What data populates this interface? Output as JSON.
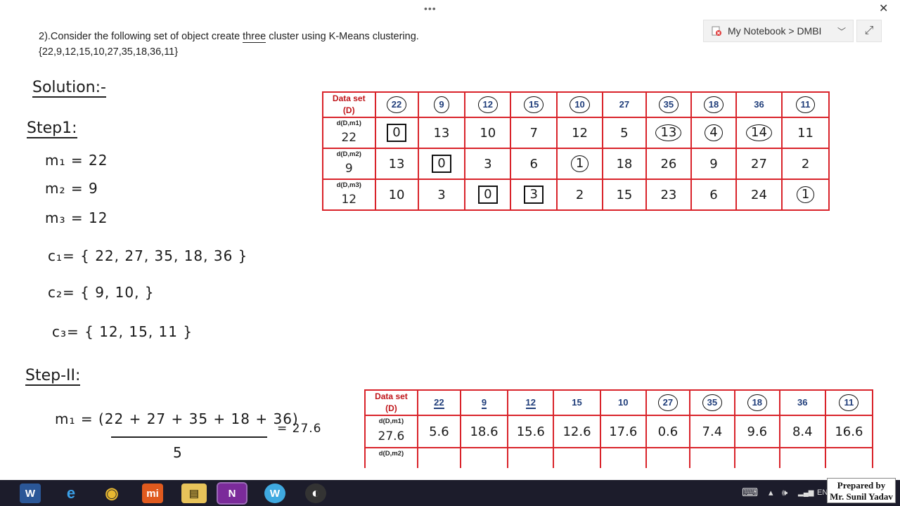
{
  "window": {
    "dots": "•••",
    "close": "✕"
  },
  "notebook": {
    "breadcrumb": "My Notebook > DMBI",
    "chevron": "﹀",
    "expand_icon": "⤢"
  },
  "question": {
    "line1_before": "2).Consider the following set of object create ",
    "line1_emph": "three",
    "line1_after": " cluster using K-Means clustering.",
    "line2": "{22,9,12,15,10,27,35,18,36,11}"
  },
  "notes": {
    "solution": "Solution:-",
    "step1": "Step1:",
    "m1": "m₁ = 22",
    "m2": "m₂ = 9",
    "m3": "m₃ = 12",
    "c1": "c₁= { 22, 27, 35, 18, 36 }",
    "c2": "c₂= { 9, 10, }",
    "c3": "c₃= { 12, 15, 11 }",
    "step2": "Step-II:",
    "m1_new_num": "m₁ = (22 + 27 + 35 + 18 + 36)",
    "m1_new_den": "5",
    "m1_new_res": "= 27.6"
  },
  "table1": {
    "header_label": [
      "Data set",
      "(D)"
    ],
    "headers": [
      "22",
      "9",
      "12",
      "15",
      "10",
      "27",
      "35",
      "18",
      "36",
      "11"
    ],
    "rows": [
      {
        "small": "d(D,m1)",
        "big": "22",
        "cells": [
          "0",
          "13",
          "10",
          "7",
          "12",
          "5",
          "13",
          "4",
          "14",
          "11"
        ]
      },
      {
        "small": "d(D,m2)",
        "big": "9",
        "cells": [
          "13",
          "0",
          "3",
          "6",
          "1",
          "18",
          "26",
          "9",
          "27",
          "2"
        ]
      },
      {
        "small": "d(D,m3)",
        "big": "12",
        "cells": [
          "10",
          "3",
          "0",
          "3",
          "2",
          "15",
          "23",
          "6",
          "24",
          "1"
        ]
      }
    ]
  },
  "table2": {
    "header_label": [
      "Data set",
      "(D)"
    ],
    "headers": [
      "22",
      "9",
      "12",
      "15",
      "10",
      "27",
      "35",
      "18",
      "36",
      "11"
    ],
    "rows": [
      {
        "small": "d(D,m1)",
        "big": "27.6",
        "cells": [
          "5.6",
          "18.6",
          "15.6",
          "12.6",
          "17.6",
          "0.6",
          "7.4",
          "9.6",
          "8.4",
          "16.6"
        ]
      },
      {
        "small": "d(D,m2)",
        "big": "",
        "cells": [
          "",
          "",
          "",
          "",
          "",
          "",
          "",
          "",
          "",
          ""
        ]
      }
    ]
  },
  "taskbar": {
    "apps": [
      {
        "name": "word",
        "label": "W"
      },
      {
        "name": "edge",
        "label": "e"
      },
      {
        "name": "chrome",
        "label": "◉"
      },
      {
        "name": "mi",
        "label": "mi"
      },
      {
        "name": "explorer",
        "label": "▤"
      },
      {
        "name": "onenote",
        "label": "N"
      },
      {
        "name": "wps",
        "label": "W"
      },
      {
        "name": "obs",
        "label": "◐"
      }
    ],
    "tray_keyboard": "⌨",
    "tray_up": "▴",
    "tray_speaker": "🕪",
    "tray_signal": "▂▄▆",
    "tray_lang": "EN"
  },
  "watermark": {
    "line1": "Prepared by",
    "line2": "Mr. Sunil Yadav"
  },
  "colors": {
    "table_border": "#d9232a",
    "header_blue": "#1f3d7a",
    "taskbar": "#1c1c2b"
  }
}
